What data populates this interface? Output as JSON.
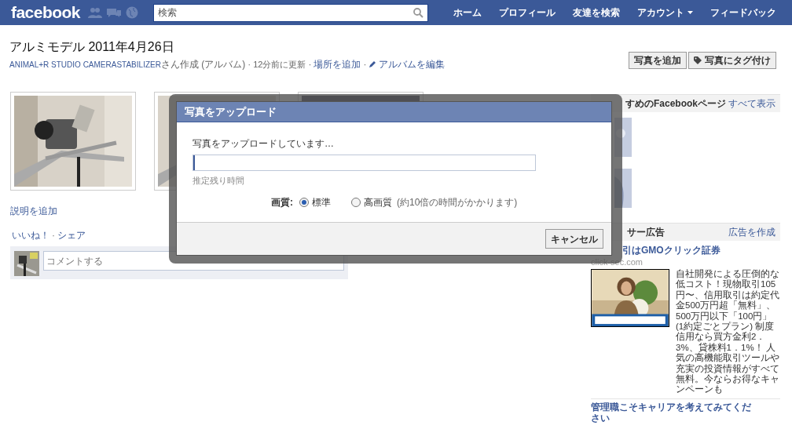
{
  "topbar": {
    "logo": "facebook",
    "search": {
      "placeholder": "検索"
    },
    "nav": [
      {
        "label": "ホーム",
        "caret": false
      },
      {
        "label": "プロフィール",
        "caret": false
      },
      {
        "label": "友達を検索",
        "caret": false
      },
      {
        "label": "アカウント",
        "caret": true
      },
      {
        "label": "フィードバック",
        "caret": false
      }
    ]
  },
  "album": {
    "title": "アルミモデル 2011年4月26日",
    "owner": "ANIMAL+R STUDIO CAMERASTABILIZER",
    "owner_suffix": "さん作成 (アルバム)",
    "updated": "12分前に更新",
    "separator": "·",
    "add_place": "場所を追加",
    "edit": "アルバムを編集",
    "buttons": [
      {
        "label": "写真を追加",
        "icon": false
      },
      {
        "label": "写真にタグ付け",
        "icon": true
      }
    ]
  },
  "photos": [
    {
      "kind": "picture"
    },
    {
      "kind": "picture"
    },
    {
      "kind": "picture"
    }
  ],
  "add_caption": "説明を追加",
  "actions": [
    "いいね！",
    "シェア"
  ],
  "actions_separator": "·",
  "comment": {
    "placeholder": "コメントする"
  },
  "sidebar": {
    "pages_heading": "すめのFacebookページ",
    "see_all": "すべて表示",
    "ads_heading": "サー広告",
    "create_ad": "広告を作成",
    "ad": {
      "title": "引はGMOクリック証券",
      "domain": "click-sec.com",
      "body": "自社開発による圧倒的な低コスト！現物取引105円〜、信用取引は約定代金500万円超「無料」、500万円以下「100円」(1約定ごとプラン) 制度信用なら買方金利2．3%、貸株料1．1%！ 人気の高機能取引ツールや充実の投資情報がすべて無料。今ならお得なキャンペーンも"
    },
    "ad2_title": "管理職こそキャリアを考えてみてください"
  },
  "dialog": {
    "title": "写真をアップロード",
    "message": "写真をアップロードしています…",
    "progress": {
      "level": 0.005
    },
    "remaining": "推定残り時間",
    "quality_label": "画質:",
    "options": [
      {
        "label": "標準",
        "selected": true
      },
      {
        "label": "高画質",
        "note": "(約10倍の時間がかかります)",
        "selected": false
      }
    ],
    "cancel": "キャンセル"
  }
}
